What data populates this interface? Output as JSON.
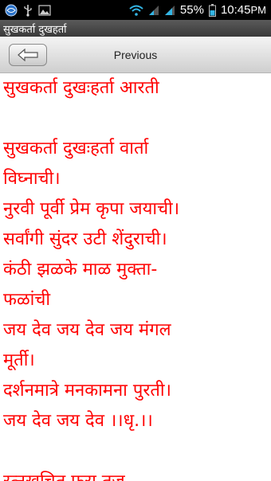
{
  "status_bar": {
    "battery_percent": "55%",
    "time": "10:45",
    "time_suffix": "PM",
    "icons": [
      "browser-globe-icon",
      "usb-icon",
      "gallery-icon",
      "wifi-icon",
      "signal-icon",
      "signal-icon",
      "battery-icon"
    ]
  },
  "app": {
    "title": "सुखकर्ता दुखहर्ता"
  },
  "nav": {
    "back_icon": "back-arrow-icon",
    "title": "Previous"
  },
  "content": {
    "lines": [
      "सुखकर्ता दुखःहर्ता आरती",
      "",
      "सुखकर्ता दुखःहर्ता वार्ता",
      "विघ्नाची।",
      "नुरवी पूर्वी प्रेम कृपा जयाची।",
      "सर्वांगी सुंदर उटी शेंदुराची।",
      "कंठी झळके माळ मुक्ता-",
      "फळांची",
      "जय देव जय देव जय मंगल",
      "मूर्ती।",
      "दर्शनमात्रे मनकामना पुरती।",
      "जय देव जय देव ।।धृ.।।",
      "",
      "रत्नखचित फरा तुज"
    ]
  },
  "colors": {
    "text": "#ff0000",
    "status_bar": "#000000",
    "accent": "#33b5e5"
  }
}
